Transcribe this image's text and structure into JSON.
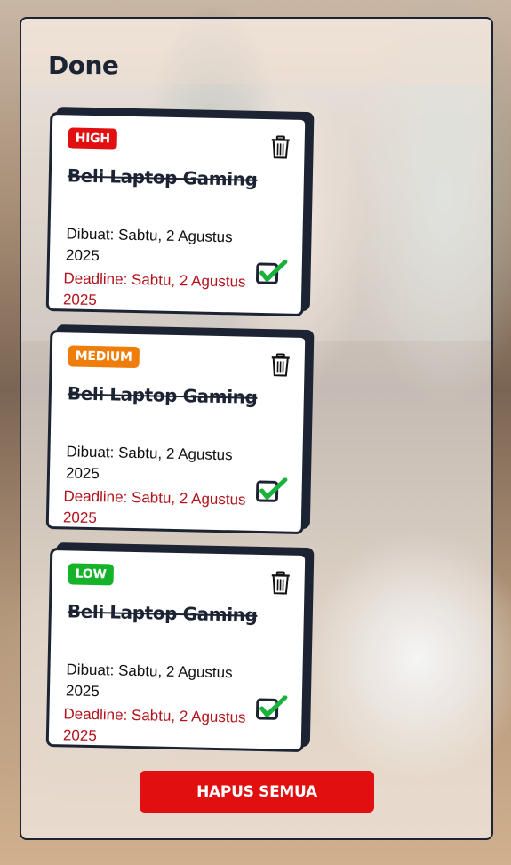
{
  "section": {
    "title": "Done"
  },
  "cards": [
    {
      "priority": "HIGH",
      "priority_color": "#e10f0f",
      "title": "Beli Laptop Gaming",
      "created": "Dibuat: Sabtu, 2 Agustus 2025",
      "deadline": "Deadline: Sabtu, 2 Agustus 2025"
    },
    {
      "priority": "MEDIUM",
      "priority_color": "#ef7d0a",
      "title": "Beli Laptop Gaming",
      "created": "Dibuat: Sabtu, 2 Agustus 2025",
      "deadline": "Deadline: Sabtu, 2 Agustus 2025"
    },
    {
      "priority": "LOW",
      "priority_color": "#15b32a",
      "title": "Beli Laptop Gaming",
      "created": "Dibuat: Sabtu, 2 Agustus 2025",
      "deadline": "Deadline: Sabtu, 2 Agustus 2025"
    }
  ],
  "actions": {
    "delete_all_label": "HAPUS SEMUA"
  },
  "icons": {
    "delete": "trash-icon",
    "completed": "checkmark-icon"
  },
  "colors": {
    "accent_dark": "#1c2333",
    "danger": "#e10f0f",
    "deadline_text": "#b3141b",
    "check_green": "#19b23b"
  }
}
